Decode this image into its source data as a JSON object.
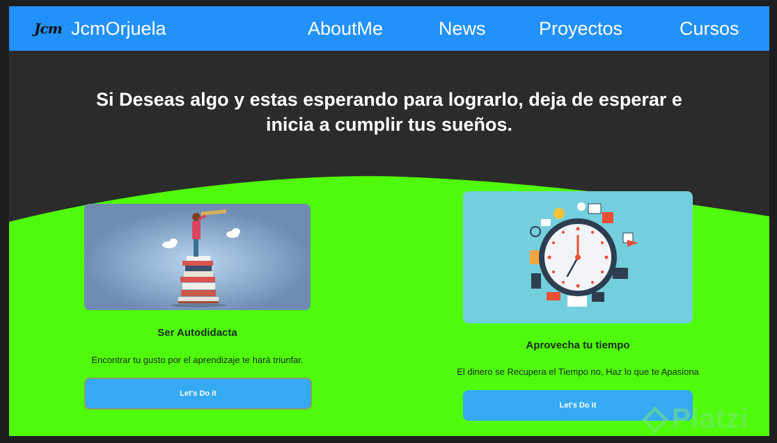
{
  "nav": {
    "logo_text": "Jcm",
    "brand": "JcmOrjuela",
    "links": [
      "AboutMe",
      "News",
      "Proyectos",
      "Cursos"
    ]
  },
  "headline": "Si Deseas algo y estas esperando para lograrlo, deja de esperar e inicia a cumplir tus sueños.",
  "cards": [
    {
      "title": "Ser Autodidacta",
      "description": "Encontrar tu gusto por el aprendizaje te hará triunfar.",
      "button": "Let's Do it",
      "image": "person-on-books-telescope"
    },
    {
      "title": "Aprovecha tu tiempo",
      "description": "El dinero se Recupera el Tiempo no, Haz lo que te Apasiona",
      "button": "Let's Do it",
      "image": "clock-with-office-items"
    }
  ],
  "watermark": "Platzi",
  "colors": {
    "navbar": "#2291fb",
    "background": "#2b2b2b",
    "wave": "#4ffb0a",
    "button": "#35aaf2"
  }
}
